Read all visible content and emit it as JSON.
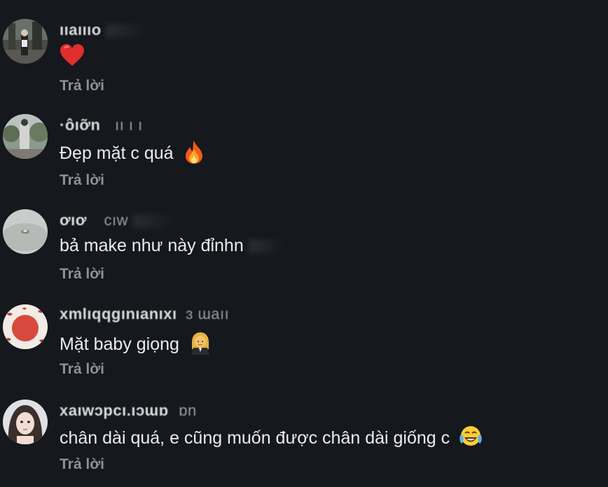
{
  "reply_label": "Trả lời",
  "comments": [
    {
      "username": "ııaıııo",
      "username_extra": "",
      "text": "",
      "emoji": "heart-icon"
    },
    {
      "username": "·ôıỡn",
      "username_extra": "ıı ı ı",
      "text": "Đẹp mặt c quá",
      "emoji": "fire-icon"
    },
    {
      "username": "ơıơ",
      "username_extra": "cıw",
      "text": "bả make như này đỉnhn",
      "emoji": ""
    },
    {
      "username": "xmlıqqgınıanıxı",
      "username_extra": "ɜ ɯaıı",
      "text": "Mặt baby giọng",
      "emoji": "woman-judge-icon"
    },
    {
      "username": "xaıwɔpcı.ıɔɯɒ",
      "username_extra": "ɒn",
      "text": "chân dài quá, e cũng muốn được chân dài giống c",
      "emoji": "tears-of-joy-icon"
    }
  ],
  "colors": {
    "background": "#15181d",
    "text": "#ececef",
    "reply": "#8d9197"
  }
}
